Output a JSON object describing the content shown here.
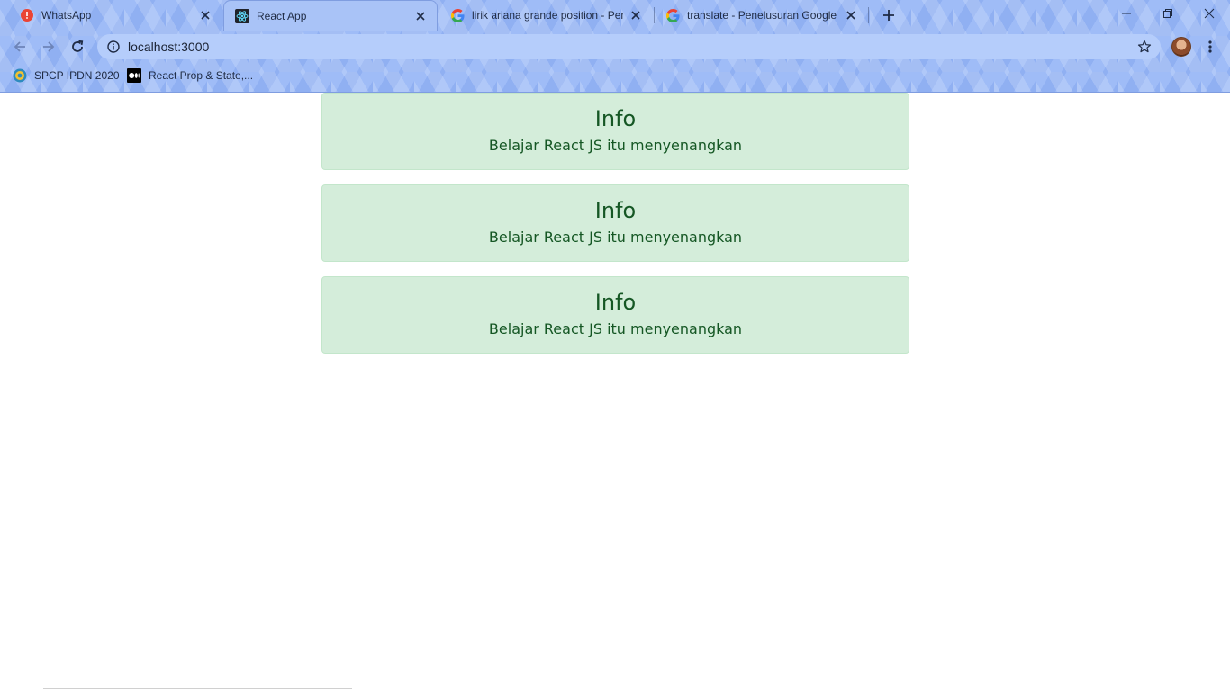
{
  "browser": {
    "tabs": [
      {
        "title": "WhatsApp",
        "icon": "whatsapp-alert-icon",
        "active": false
      },
      {
        "title": "React App",
        "icon": "react-icon",
        "active": true
      },
      {
        "title": "lirik ariana grande position - Penelusuran Google",
        "icon": "google-icon",
        "active": false
      },
      {
        "title": "translate - Penelusuran Google",
        "icon": "google-icon",
        "active": false
      }
    ],
    "url": "localhost:3000",
    "bookmarks": [
      {
        "label": "SPCP IPDN 2020",
        "icon": "ipdn-logo-icon"
      },
      {
        "label": "React Prop & State,...",
        "icon": "medium-icon"
      }
    ],
    "colors": {
      "chrome_bg": "#9fbcf7",
      "omnibox_bg": "#b5cdfb"
    }
  },
  "page": {
    "alerts": [
      {
        "heading": "Info",
        "text": "Belajar React JS itu menyenangkan"
      },
      {
        "heading": "Info",
        "text": "Belajar React JS itu menyenangkan"
      },
      {
        "heading": "Info",
        "text": "Belajar React JS itu menyenangkan"
      }
    ],
    "colors": {
      "alert_bg": "#d4edda",
      "alert_border": "#c3e6cb",
      "alert_text": "#155724"
    }
  }
}
